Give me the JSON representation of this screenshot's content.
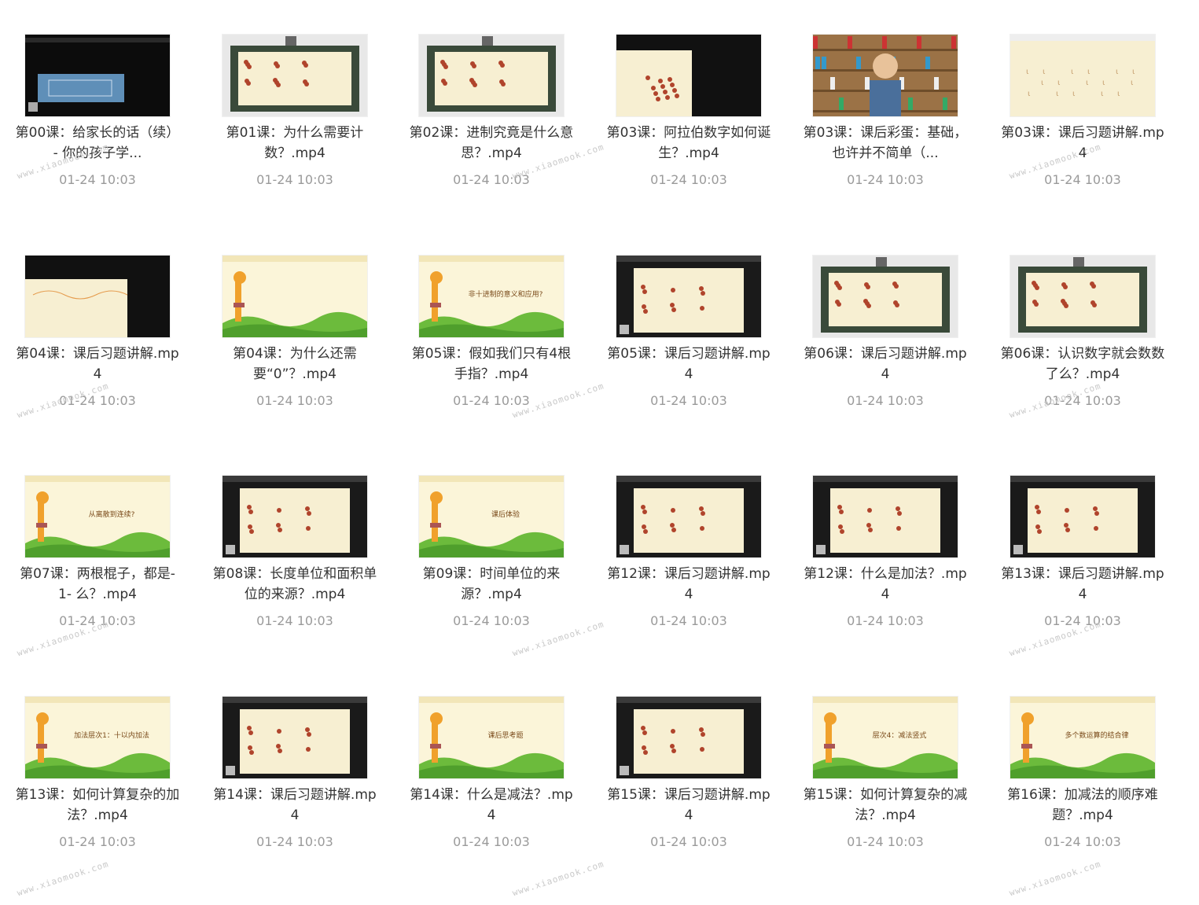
{
  "watermark": "www.xiaomook.com",
  "colors": {
    "title": "#333333",
    "date": "#9a9a9a",
    "board_cream": "#f7efd2",
    "board_dark": "#111111",
    "grass": "#6cbb3c",
    "sky": "#fbf5d9"
  },
  "items": [
    {
      "title": "第00课：给家长的话（续）- 你的孩子学...",
      "date": "01-24 10:03",
      "thumb": "dark-blue"
    },
    {
      "title": "第01课：为什么需要计数？.mp4",
      "date": "01-24 10:03",
      "thumb": "chalkboard"
    },
    {
      "title": "第02课：进制究竟是什么意思？.mp4",
      "date": "01-24 10:03",
      "thumb": "chalkboard"
    },
    {
      "title": "第03课：阿拉伯数字如何诞生？.mp4",
      "date": "01-24 10:03",
      "thumb": "dark-dots"
    },
    {
      "title": "第03课：课后彩蛋：基础，也许并不简单（...",
      "date": "01-24 10:03",
      "thumb": "teacher"
    },
    {
      "title": "第03课：课后习题讲解.mp4",
      "date": "01-24 10:03",
      "thumb": "cream"
    },
    {
      "title": "第04课：课后习题讲解.mp4",
      "date": "01-24 10:03",
      "thumb": "dark-cream"
    },
    {
      "title": "第04课：为什么还需要“0”？.mp4",
      "date": "01-24 10:03",
      "thumb": "giraffe",
      "slide": ""
    },
    {
      "title": "第05课：假如我们只有4根手指？.mp4",
      "date": "01-24 10:03",
      "thumb": "giraffe",
      "slide": "非十进制的意义和应用?"
    },
    {
      "title": "第05课：课后习题讲解.mp4",
      "date": "01-24 10:03",
      "thumb": "dark-board"
    },
    {
      "title": "第06课：课后习题讲解.mp4",
      "date": "01-24 10:03",
      "thumb": "chalkboard"
    },
    {
      "title": "第06课：认识数字就会数数了么？.mp4",
      "date": "01-24 10:03",
      "thumb": "chalkboard"
    },
    {
      "title": "第07课：两根棍子，都是- 1- 么？.mp4",
      "date": "01-24 10:03",
      "thumb": "giraffe",
      "slide": "从离散到连续?"
    },
    {
      "title": "第08课：长度单位和面积单位的来源？.mp4",
      "date": "01-24 10:03",
      "thumb": "dark-board"
    },
    {
      "title": "第09课：时间单位的来源？.mp4",
      "date": "01-24 10:03",
      "thumb": "giraffe",
      "slide": "课后体验"
    },
    {
      "title": "第12课：课后习题讲解.mp4",
      "date": "01-24 10:03",
      "thumb": "dark-board"
    },
    {
      "title": "第12课：什么是加法？.mp4",
      "date": "01-24 10:03",
      "thumb": "dark-board"
    },
    {
      "title": "第13课：课后习题讲解.mp4",
      "date": "01-24 10:03",
      "thumb": "dark-board"
    },
    {
      "title": "第13课：如何计算复杂的加法？.mp4",
      "date": "01-24 10:03",
      "thumb": "giraffe",
      "slide": "加法层次1：十以内加法"
    },
    {
      "title": "第14课：课后习题讲解.mp4",
      "date": "01-24 10:03",
      "thumb": "dark-board"
    },
    {
      "title": "第14课：什么是减法？.mp4",
      "date": "01-24 10:03",
      "thumb": "giraffe",
      "slide": "课后思考题"
    },
    {
      "title": "第15课：课后习题讲解.mp4",
      "date": "01-24 10:03",
      "thumb": "dark-board"
    },
    {
      "title": "第15课：如何计算复杂的减法？.mp4",
      "date": "01-24 10:03",
      "thumb": "giraffe",
      "slide": "层次4：减法竖式"
    },
    {
      "title": "第16课：加减法的顺序难题？.mp4",
      "date": "01-24 10:03",
      "thumb": "giraffe",
      "slide": "多个数运算的结合律"
    }
  ]
}
